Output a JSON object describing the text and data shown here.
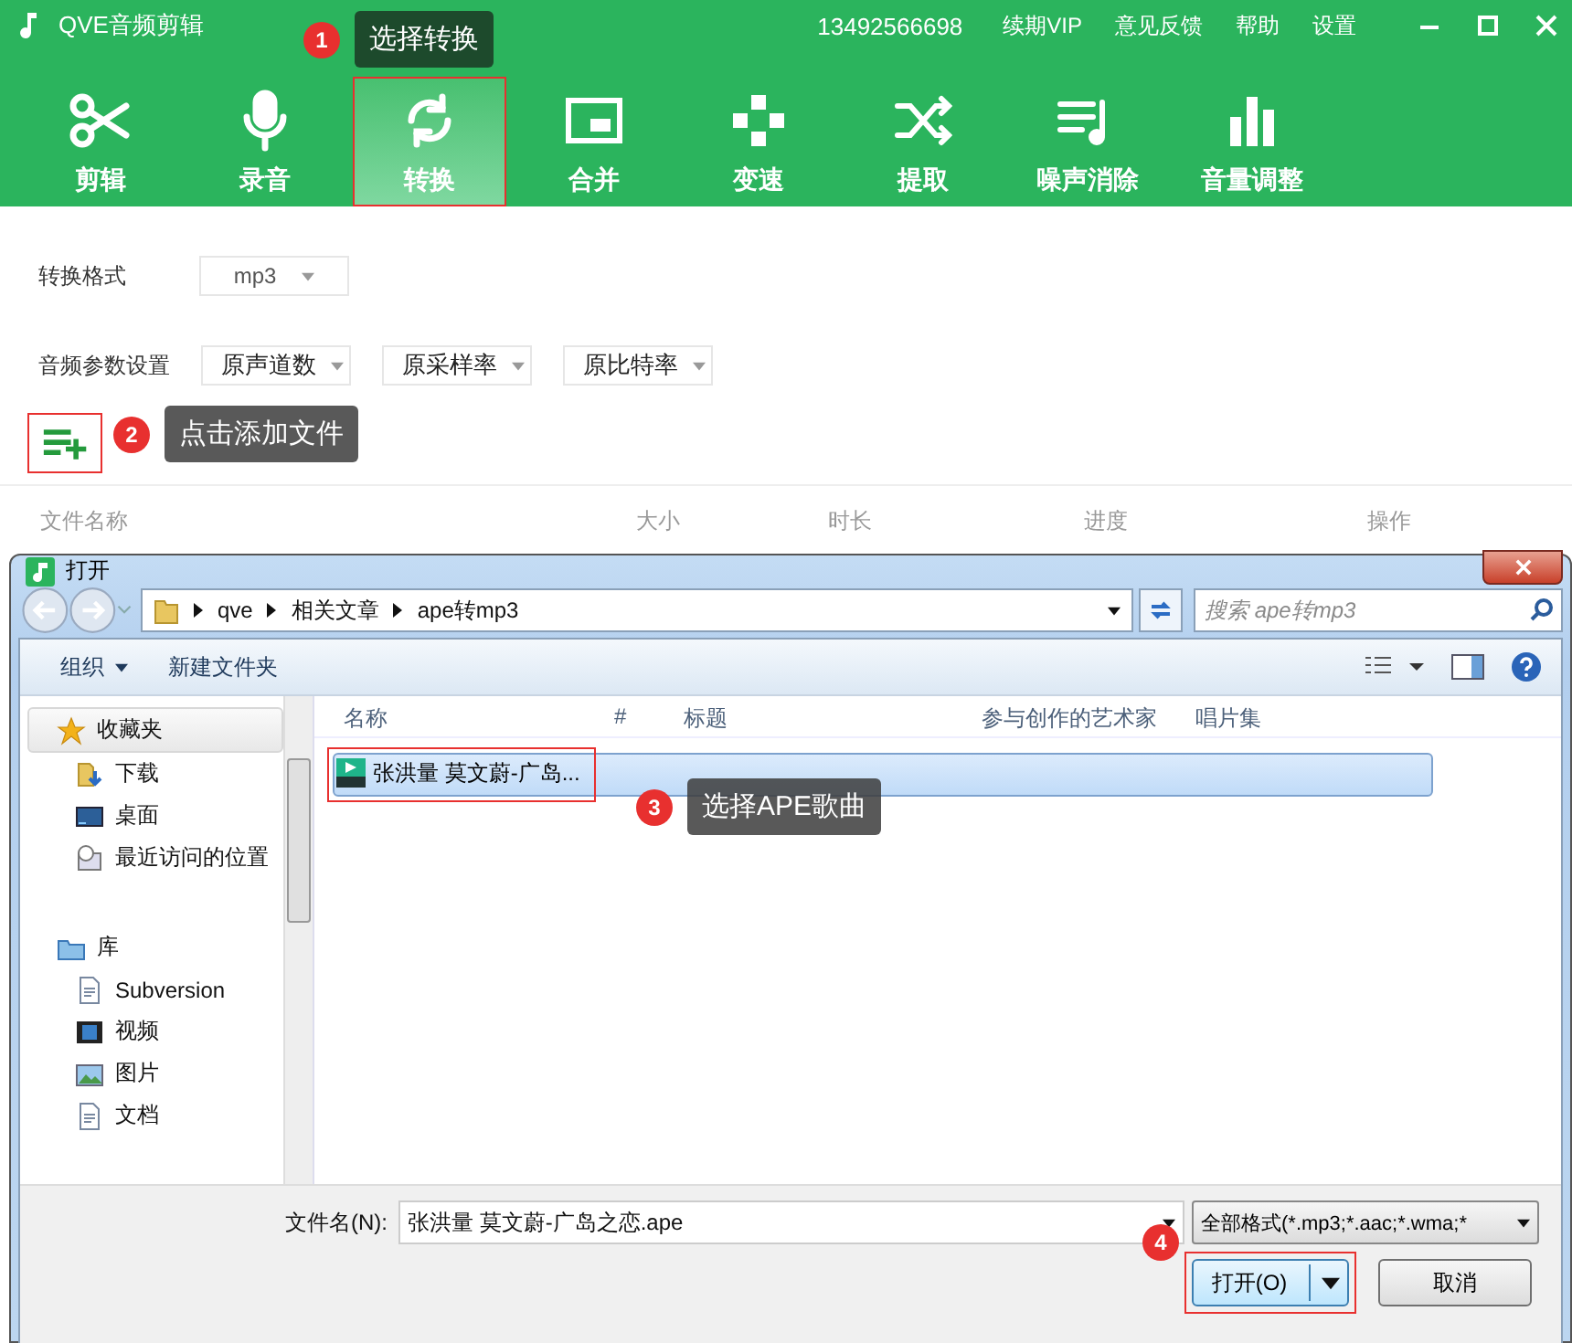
{
  "app": {
    "title": "QVE音频剪辑",
    "phone": "13492566698",
    "menu": [
      "续期VIP",
      "意见反馈",
      "帮助",
      "设置"
    ]
  },
  "toolbar": [
    {
      "label": "剪辑",
      "kind": "scissors",
      "selected": false
    },
    {
      "label": "录音",
      "kind": "mic",
      "selected": false
    },
    {
      "label": "转换",
      "kind": "convert",
      "selected": true
    },
    {
      "label": "合并",
      "kind": "merge",
      "selected": false
    },
    {
      "label": "变速",
      "kind": "speed",
      "selected": false
    },
    {
      "label": "提取",
      "kind": "shuffle",
      "selected": false
    },
    {
      "label": "噪声消除",
      "kind": "playlist",
      "selected": false
    },
    {
      "label": "音量调整",
      "kind": "bars",
      "selected": false
    }
  ],
  "settings": {
    "format_label": "转换格式",
    "format": "mp3",
    "params_label": "音频参数设置",
    "params": [
      "原声道数",
      "原采样率",
      "原比特率"
    ]
  },
  "add_button": {
    "highlighted": true
  },
  "file_table": {
    "columns": [
      "文件名称",
      "大小",
      "时长",
      "进度",
      "操作"
    ]
  },
  "dialog": {
    "title": "打开",
    "path": [
      "qve",
      "相关文章",
      "ape转mp3"
    ],
    "search": {
      "placeholder": "搜索 ape转mp3"
    },
    "commands": [
      "组织",
      "新建文件夹"
    ],
    "nav": [
      {
        "label": "收藏夹",
        "kind": "star",
        "selected": true,
        "children": [
          {
            "label": "下载",
            "kind": "download",
            "selected": false
          },
          {
            "label": "桌面",
            "kind": "desktop",
            "selected": false
          },
          {
            "label": "最近访问的位置",
            "kind": "recent",
            "selected": false
          }
        ]
      },
      {
        "label": "库",
        "kind": "library",
        "selected": false,
        "children": [
          {
            "label": "Subversion",
            "kind": "doc",
            "selected": false
          },
          {
            "label": "视频",
            "kind": "film",
            "selected": false
          },
          {
            "label": "图片",
            "kind": "image",
            "selected": false
          },
          {
            "label": "文档",
            "kind": "doc",
            "selected": false
          }
        ]
      }
    ],
    "columns": [
      "名称",
      "#",
      "标题",
      "参与创作的艺术家",
      "唱片集"
    ],
    "files": [
      {
        "name": "张洪量 莫文蔚-广岛...",
        "selected": true,
        "highlighted": true
      }
    ],
    "filename_label": "文件名(N):",
    "filename": "张洪量 莫文蔚-广岛之恋.ape",
    "filter": "全部格式(*.mp3;*.aac;*.wma;*",
    "buttons": [
      {
        "label": "打开(O)",
        "kind": "split",
        "highlighted": true
      },
      {
        "label": "取消",
        "kind": "plain",
        "highlighted": false
      }
    ]
  },
  "callouts": [
    {
      "number": "1",
      "text": "选择转换"
    },
    {
      "number": "2",
      "text": "点击添加文件"
    },
    {
      "number": "3",
      "text": "选择APE歌曲"
    },
    {
      "number": "4"
    }
  ]
}
